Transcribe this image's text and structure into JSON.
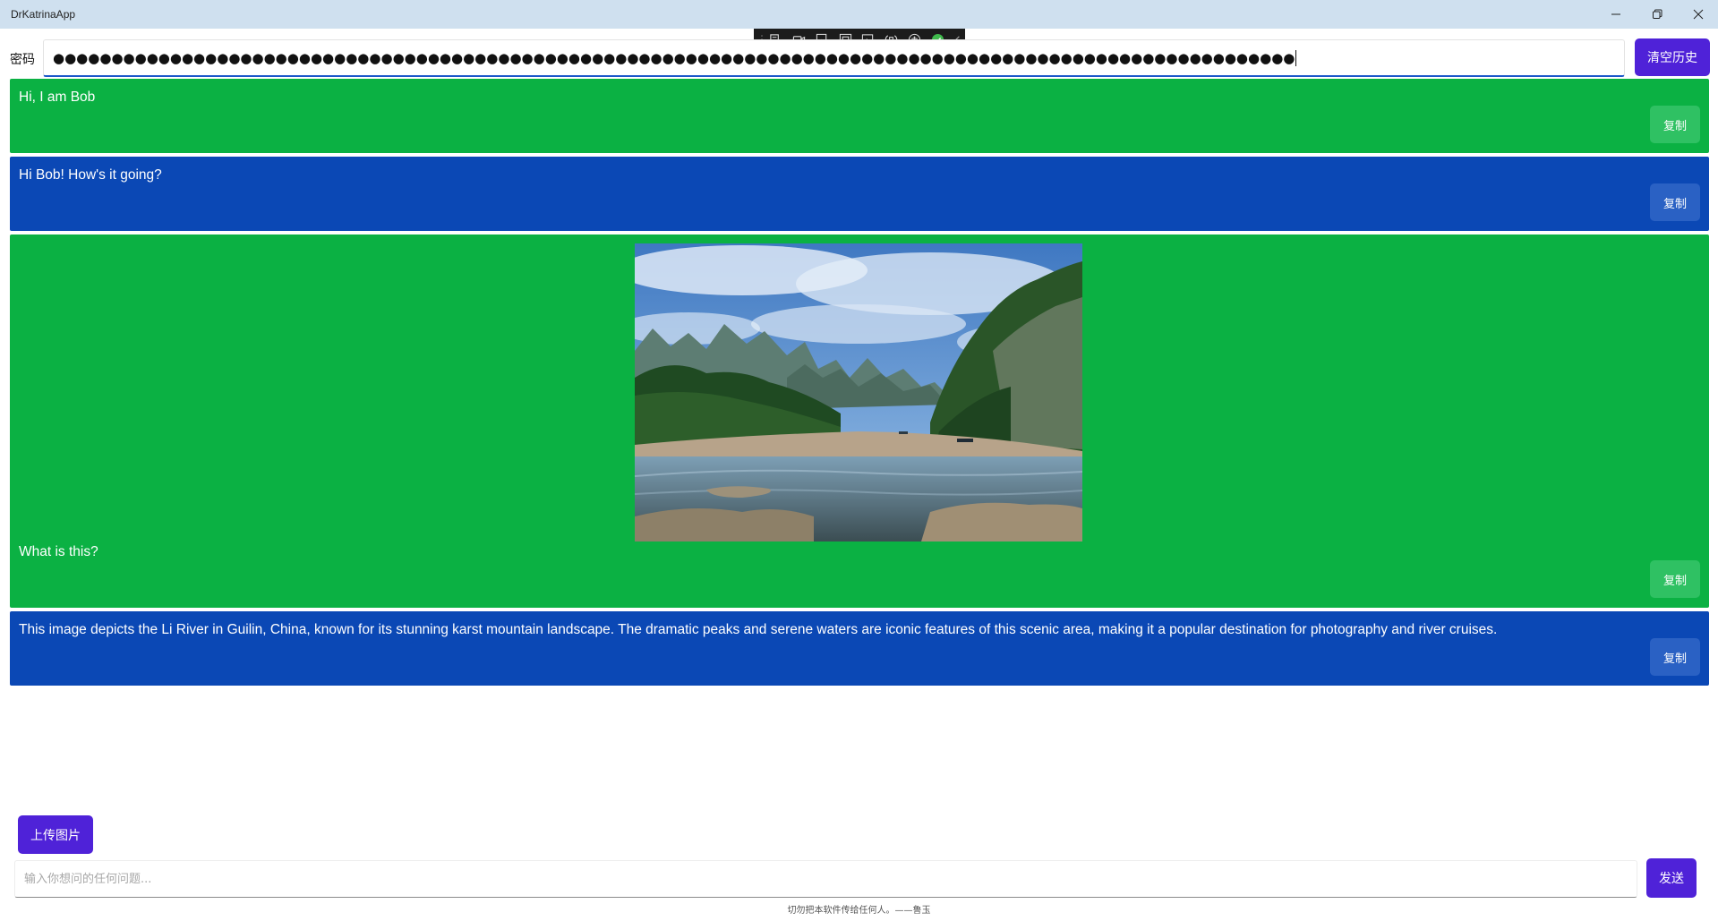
{
  "app": {
    "title": "DrKatrinaApp"
  },
  "password": {
    "label": "密码",
    "masked_value": "●●●●●●●●●●●●●●●●●●●●●●●●●●●●●●●●●●●●●●●●●●●●●●●●●●●●●●●●●●●●●●●●●●●●●●●●●●●●●●●●●●●●●●●●●●●●●●●●●●●●●●●●●●",
    "clear_history_label": "清空历史"
  },
  "messages": [
    {
      "role": "user",
      "text": "Hi, I am Bob",
      "copy_label": "复制"
    },
    {
      "role": "assistant",
      "text": "Hi Bob! How's it going?",
      "copy_label": "复制"
    },
    {
      "role": "user",
      "text": "What is this?",
      "copy_label": "复制",
      "image": "li-river-karst-landscape-photo"
    },
    {
      "role": "assistant",
      "text": "This image depicts the Li River in Guilin, China, known for its stunning karst mountain landscape. The dramatic peaks and serene waters are iconic features of this scenic area, making it a popular destination for photography and river cruises.",
      "copy_label": "复制"
    }
  ],
  "composer": {
    "upload_label": "上传图片",
    "input_value": "",
    "input_placeholder": "输入你想问的任何问题...",
    "send_label": "发送"
  },
  "footer": {
    "text": "切勿把本软件传给任何人。——鲁玉"
  },
  "colors": {
    "user_bubble": "#0bb143",
    "assistant_bubble": "#0b48b5",
    "accent_button": "#4f22d8",
    "titlebar": "#cfe0ef"
  },
  "icons": {
    "window": [
      "minimize-icon",
      "restore-icon",
      "close-icon"
    ],
    "devbar": [
      "live-visual-tree-icon",
      "video-icon",
      "select-element-icon",
      "display-layout-adorners-icon",
      "track-focus-icon",
      "hot-reload-icon",
      "accessibility-icon",
      "check-circle-icon",
      "collapse-chevron-icon"
    ]
  }
}
